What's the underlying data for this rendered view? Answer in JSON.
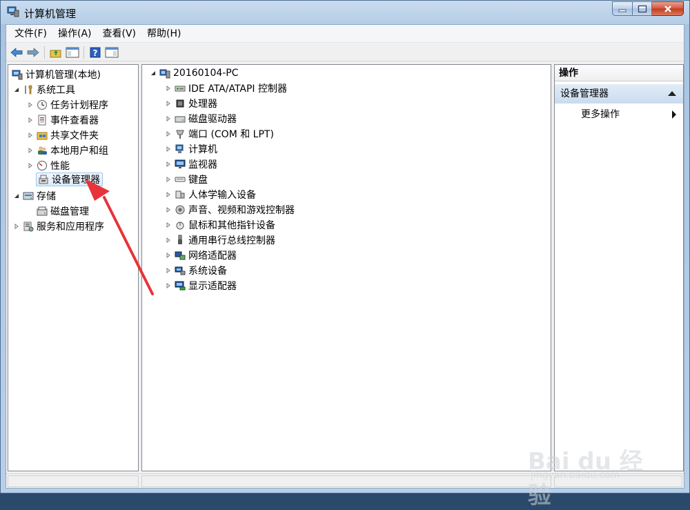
{
  "window": {
    "title": "计算机管理"
  },
  "menubar": {
    "items": [
      "文件(F)",
      "操作(A)",
      "查看(V)",
      "帮助(H)"
    ]
  },
  "left_tree": {
    "root": "计算机管理(本地)",
    "items": [
      {
        "label": "系统工具",
        "icon": "tools-icon"
      },
      {
        "label": "任务计划程序",
        "icon": "clock-icon"
      },
      {
        "label": "事件查看器",
        "icon": "event-viewer-icon"
      },
      {
        "label": "共享文件夹",
        "icon": "shared-folder-icon"
      },
      {
        "label": "本地用户和组",
        "icon": "users-icon"
      },
      {
        "label": "性能",
        "icon": "performance-icon"
      },
      {
        "label": "设备管理器",
        "icon": "device-manager-icon"
      },
      {
        "label": "存储",
        "icon": "storage-icon"
      },
      {
        "label": "磁盘管理",
        "icon": "disk-icon"
      },
      {
        "label": "服务和应用程序",
        "icon": "services-icon"
      }
    ]
  },
  "device_tree": {
    "root": "20160104-PC",
    "items": [
      {
        "label": "IDE ATA/ATAPI 控制器",
        "icon": "ide-controller-icon"
      },
      {
        "label": "处理器",
        "icon": "processor-icon"
      },
      {
        "label": "磁盘驱动器",
        "icon": "disk-drive-icon"
      },
      {
        "label": "端口 (COM 和 LPT)",
        "icon": "port-icon"
      },
      {
        "label": "计算机",
        "icon": "computer-icon"
      },
      {
        "label": "监视器",
        "icon": "monitor-icon"
      },
      {
        "label": "键盘",
        "icon": "keyboard-icon"
      },
      {
        "label": "人体学输入设备",
        "icon": "hid-icon"
      },
      {
        "label": "声音、视频和游戏控制器",
        "icon": "sound-icon"
      },
      {
        "label": "鼠标和其他指针设备",
        "icon": "mouse-icon"
      },
      {
        "label": "通用串行总线控制器",
        "icon": "usb-icon"
      },
      {
        "label": "网络适配器",
        "icon": "network-icon"
      },
      {
        "label": "系统设备",
        "icon": "system-device-icon"
      },
      {
        "label": "显示适配器",
        "icon": "display-adapter-icon"
      }
    ]
  },
  "actions": {
    "header": "操作",
    "group": "设备管理器",
    "more": "更多操作"
  },
  "watermark": {
    "brand": "Bai du 经验",
    "url": "jingyan.baidu.com"
  },
  "colors": {
    "annotation_arrow": "#e8333a",
    "selection": "#dbeafc",
    "action_group": "#c9dbef"
  }
}
